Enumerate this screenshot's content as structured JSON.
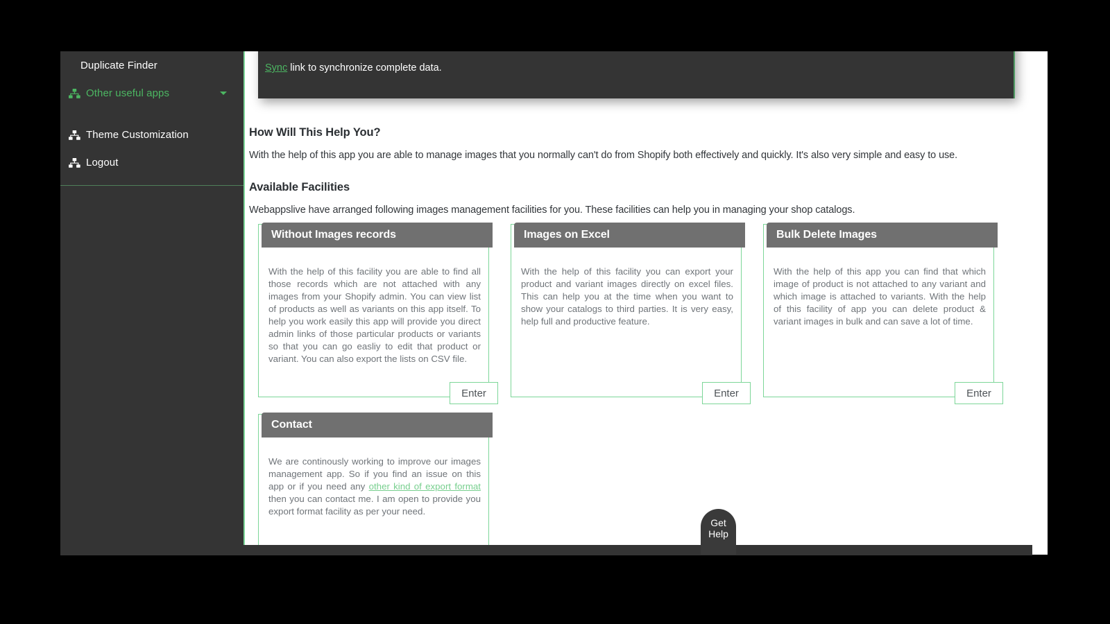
{
  "colors": {
    "accent_green": "#4cb662",
    "border_green": "#7cd698",
    "sidebar_bg": "#343434",
    "card_header_bg": "#707070",
    "body_text": "#6f7479",
    "page_bg": "#ffffff"
  },
  "sidebar": {
    "items": [
      {
        "label": "Duplicate Finder",
        "icon": "none",
        "child": true,
        "accent": false,
        "caret": false
      },
      {
        "label": "Other useful apps",
        "icon": "sitemap-icon",
        "child": false,
        "accent": true,
        "caret": true
      },
      {
        "label": "Theme Customization",
        "icon": "sitemap-icon",
        "child": false,
        "accent": false,
        "caret": false
      },
      {
        "label": "Logout",
        "icon": "sitemap-icon",
        "child": false,
        "accent": false,
        "caret": false
      }
    ]
  },
  "info_panel": {
    "link_label": "Sync",
    "text": " link to synchronize complete data."
  },
  "main": {
    "heading_help": "How Will This Help You?",
    "para_help": "With the help of this app you are able to manage images that you normally can't do from Shopify both effectively and quickly. It's also very simple and easy to use.",
    "heading_facilities": "Available Facilities",
    "para_facilities": "Webappslive have arranged following images management facilities for you. These facilities can help you in managing your shop catalogs.",
    "cards": [
      {
        "title": "Without Images records",
        "body": "With the help of this facility you are able to find all those records which are not attached with any images from your Shopify admin. You can view list of products as well as variants on this app itself. To help you work easily this app will provide you direct admin links of those particular products or variants so that you can go easliy to edit that product or variant. You can also export the lists on CSV file.",
        "button": "Enter"
      },
      {
        "title": "Images on Excel",
        "body": "With the help of this facility you can export your product and variant images directly on excel files. This can help you at the time when you want to show your catalogs to third parties. It is very easy, help full and productive feature.",
        "button": "Enter"
      },
      {
        "title": "Bulk Delete Images",
        "body": "With the help of this app you can find that which image of product is not attached to any variant and which image is attached to variants. With the help of this facility of app you can delete product & variant images in bulk and can save a lot of time.",
        "button": "Enter"
      }
    ],
    "contact_card": {
      "title": "Contact",
      "body_part1": "We are continously working to improve our images management app. So if you find an issue on this app or if you need any ",
      "body_link": "other kind of export format",
      "body_part2": " then you can contact me. I am open to provide you export format facility as per your need."
    }
  },
  "widgets": {
    "get_help_label": "Get Help"
  }
}
